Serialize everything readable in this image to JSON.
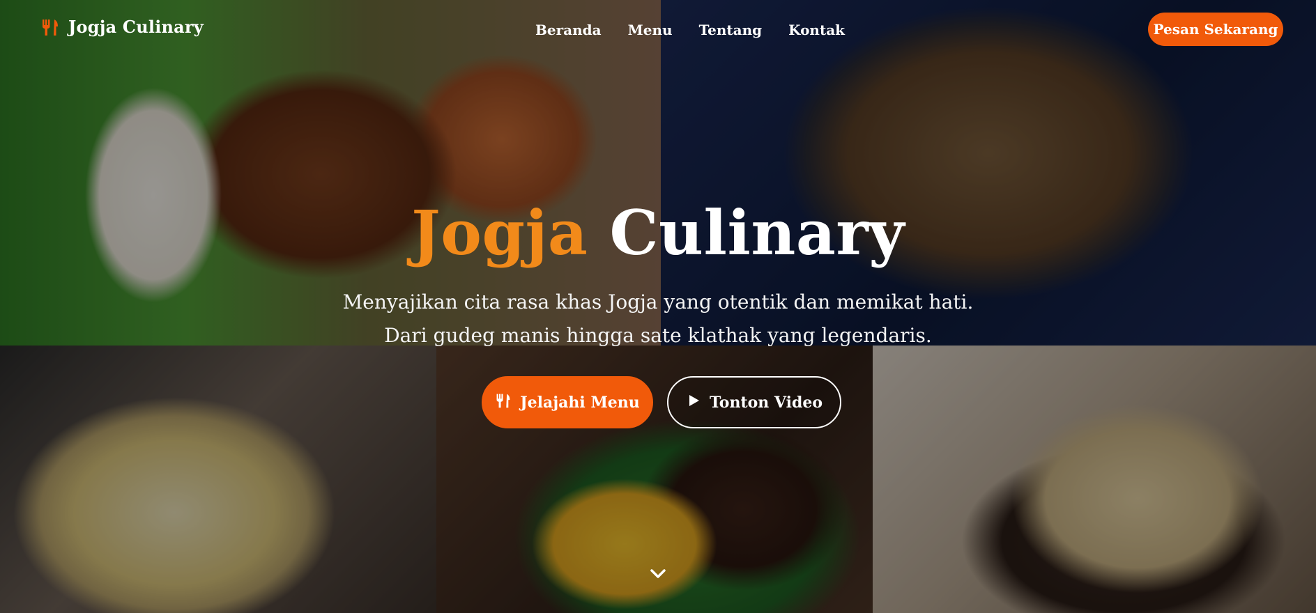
{
  "brand": {
    "name": "Jogja Culinary",
    "icon": "utensils-icon",
    "accent": "#f15a0a"
  },
  "nav": {
    "links": [
      "Beranda",
      "Menu",
      "Tentang",
      "Kontak"
    ],
    "cta": "Pesan Sekarang"
  },
  "hero": {
    "title_accent": "Jogja",
    "title_rest": "Culinary",
    "subtitle_line1": "Menyajikan cita rasa khas Jogja yang otentik dan memikat hati.",
    "subtitle_line2": "Dari gudeg manis hingga sate klathak yang legendaris.",
    "buttons": [
      {
        "label": "Jelajahi Menu",
        "icon": "utensils-icon"
      },
      {
        "label": "Tonton Video",
        "icon": "play-icon"
      }
    ],
    "scroll_icon": "chevron-down-icon"
  },
  "colors": {
    "primary": "#f15a0a",
    "title_accent": "#f28a1a",
    "text": "#ffffff"
  }
}
